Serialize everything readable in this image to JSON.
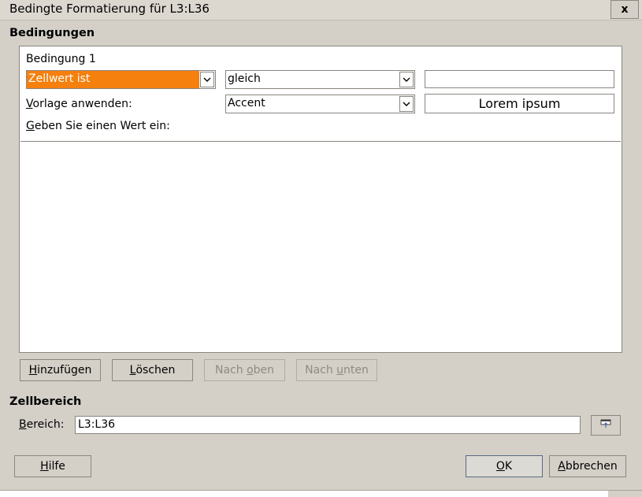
{
  "window": {
    "title": "Bedingte Formatierung für L3:L36",
    "close_label": "x"
  },
  "conditions": {
    "section_label": "Bedingungen",
    "items": [
      {
        "title": "Bedingung 1",
        "type_value": "Zellwert ist",
        "operator_value": "gleich",
        "value_input": "",
        "apply_style_label_prefix": "V",
        "apply_style_label_rest": "orlage anwenden:",
        "style_value": "Accent",
        "preview_text": "Lorem ipsum",
        "enter_value_prefix": "G",
        "enter_value_rest": "eben Sie einen Wert ein:"
      }
    ]
  },
  "buttons": {
    "add_prefix": "H",
    "add_rest": "inzufügen",
    "delete_prefix": "L",
    "delete_rest": "öschen",
    "up_pre": "Nach ",
    "up_u": "o",
    "up_rest": "ben",
    "down_pre": "Nach ",
    "down_u": "u",
    "down_rest": "nten",
    "help_prefix": "H",
    "help_rest": "ilfe",
    "ok_prefix": "O",
    "ok_rest": "K",
    "cancel_prefix": "A",
    "cancel_rest": "bbrechen"
  },
  "cell_range": {
    "section_label": "Zellbereich",
    "label_prefix": "B",
    "label_rest": "ereich:",
    "value": "L3:L36"
  },
  "colors": {
    "highlight": "#f5800e",
    "dialog_bg": "#d4d0c8"
  },
  "icons": {
    "dropdown": "chevron-down-icon",
    "shrink": "shrink-dialog-icon"
  }
}
